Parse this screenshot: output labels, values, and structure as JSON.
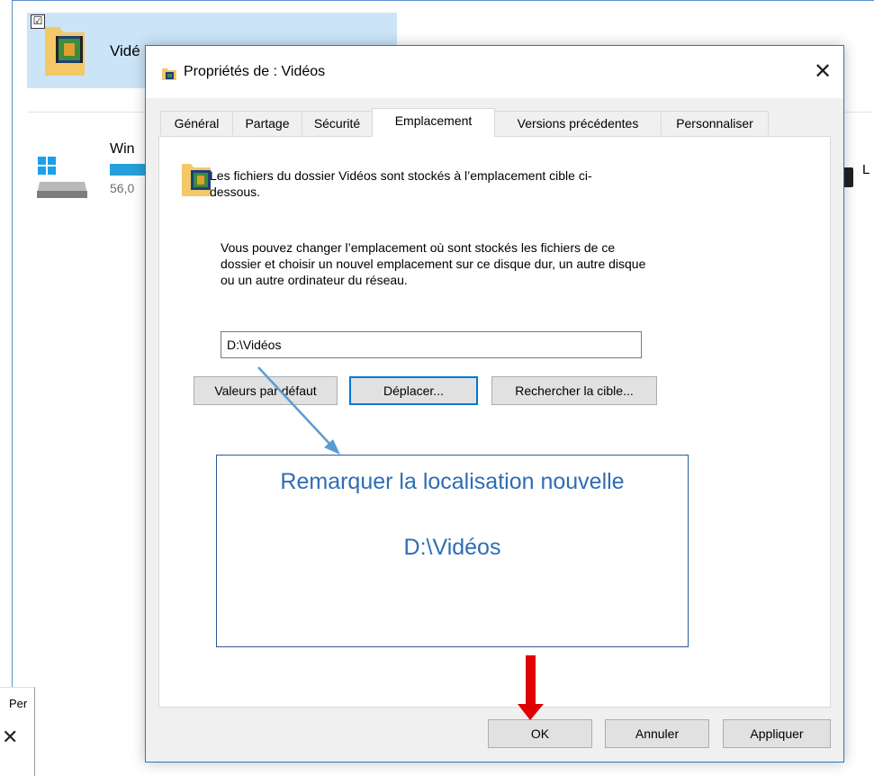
{
  "background_window": {
    "selected_item_label": "Vidé",
    "drive_label": "Win",
    "drive_size": "56,0",
    "right_label": "L",
    "lower_tab_label": "Per",
    "lower_close": "✕"
  },
  "dialog": {
    "title": "Propriétés de : Vidéos",
    "close_glyph": "✕",
    "tabs": [
      {
        "label": "Général"
      },
      {
        "label": "Partage"
      },
      {
        "label": "Sécurité"
      },
      {
        "label": "Emplacement",
        "active": true
      },
      {
        "label": "Versions précédentes"
      },
      {
        "label": "Personnaliser"
      }
    ],
    "info_text": "Les fichiers du dossier Vidéos sont stockés à l’emplacement cible ci-dessous.",
    "description": "Vous pouvez changer l’emplacement où sont stockés les fichiers de ce dossier et choisir un nouvel emplacement sur ce disque dur, un autre disque ou un autre ordinateur du réseau.",
    "path_value": "D:\\Vidéos",
    "buttons": {
      "default": "Valeurs par défaut",
      "move": "Déplacer...",
      "find_target": "Rechercher la cible..."
    },
    "footer": {
      "ok": "OK",
      "cancel": "Annuler",
      "apply": "Appliquer"
    }
  },
  "annotation": {
    "line1": "Remarquer la localisation nouvelle",
    "line2": "D:\\Vidéos",
    "text_color": "#2e6db4",
    "pointer_arrow_color": "#5b9bd5",
    "ok_arrow_color": "#e00000"
  }
}
